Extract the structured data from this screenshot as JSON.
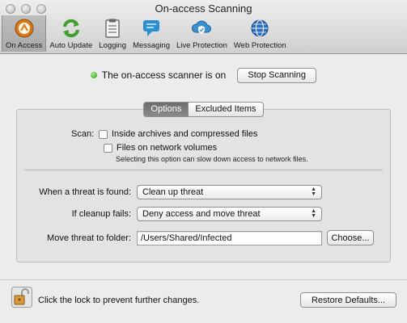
{
  "window": {
    "title": "On-access Scanning"
  },
  "toolbar": {
    "items": [
      {
        "label": "On Access",
        "icon": "on-access-icon",
        "selected": true
      },
      {
        "label": "Auto Update",
        "icon": "refresh-icon",
        "selected": false
      },
      {
        "label": "Logging",
        "icon": "clipboard-icon",
        "selected": false
      },
      {
        "label": "Messaging",
        "icon": "chat-icon",
        "selected": false
      },
      {
        "label": "Live Protection",
        "icon": "cloud-shield-icon",
        "selected": false
      },
      {
        "label": "Web Protection",
        "icon": "globe-icon",
        "selected": false
      }
    ]
  },
  "status": {
    "text": "The on-access scanner is on",
    "indicator_color": "#2b9a17",
    "button": "Stop Scanning"
  },
  "tabs": [
    {
      "label": "Options",
      "active": true
    },
    {
      "label": "Excluded Items",
      "active": false
    }
  ],
  "options": {
    "scan_label": "Scan:",
    "archives": {
      "label": "Inside archives and compressed files",
      "checked": false
    },
    "network": {
      "label": "Files on network volumes",
      "checked": false
    },
    "network_note": "Selecting this option can slow down access to network files.",
    "threat_found": {
      "label": "When a threat is found:",
      "value": "Clean up threat"
    },
    "cleanup_fails": {
      "label": "If cleanup fails:",
      "value": "Deny access and move threat"
    },
    "move_folder": {
      "label": "Move threat to folder:",
      "value": "/Users/Shared/Infected",
      "button": "Choose..."
    }
  },
  "footer": {
    "lock_text": "Click the lock to prevent further changes.",
    "restore_button": "Restore Defaults..."
  }
}
